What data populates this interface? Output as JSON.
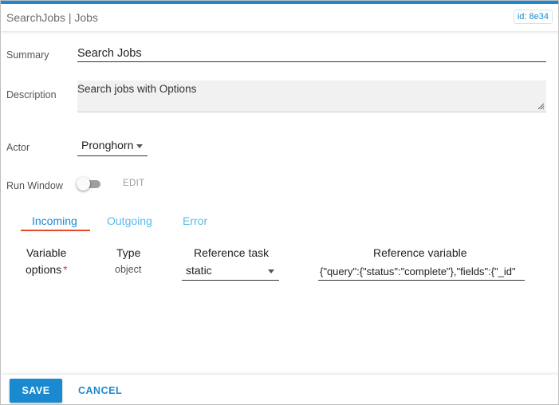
{
  "window": {
    "title": "SearchJobs | Jobs",
    "id_badge": "id: 8e34"
  },
  "colors": {
    "accent": "#1a8ad0",
    "tab_indicator": "#e8492e",
    "required": "#e53935"
  },
  "form": {
    "summary_label": "Summary",
    "summary_value": "Search Jobs",
    "description_label": "Description",
    "description_value": "Search jobs with Options",
    "actor_label": "Actor",
    "actor_value": "Pronghorn",
    "run_window_label": "Run Window",
    "run_window_enabled": false,
    "edit_label": "EDIT"
  },
  "tabs": [
    {
      "label": "Incoming",
      "active": true
    },
    {
      "label": "Outgoing",
      "active": false
    },
    {
      "label": "Error",
      "active": false
    }
  ],
  "variables_table": {
    "headers": [
      "Variable",
      "Type",
      "Reference task",
      "Reference variable"
    ],
    "rows": [
      {
        "variable": "options",
        "required_mark": "*",
        "type": "object",
        "reference_task": "static",
        "reference_variable": "{\"query\":{\"status\":\"complete\"},\"fields\":{\"_id\""
      }
    ]
  },
  "footer": {
    "save_label": "SAVE",
    "cancel_label": "CANCEL"
  },
  "icons": {
    "dropdown": "caret-down-icon",
    "resize": "resize-handle-icon",
    "toggle": "toggle-switch"
  }
}
